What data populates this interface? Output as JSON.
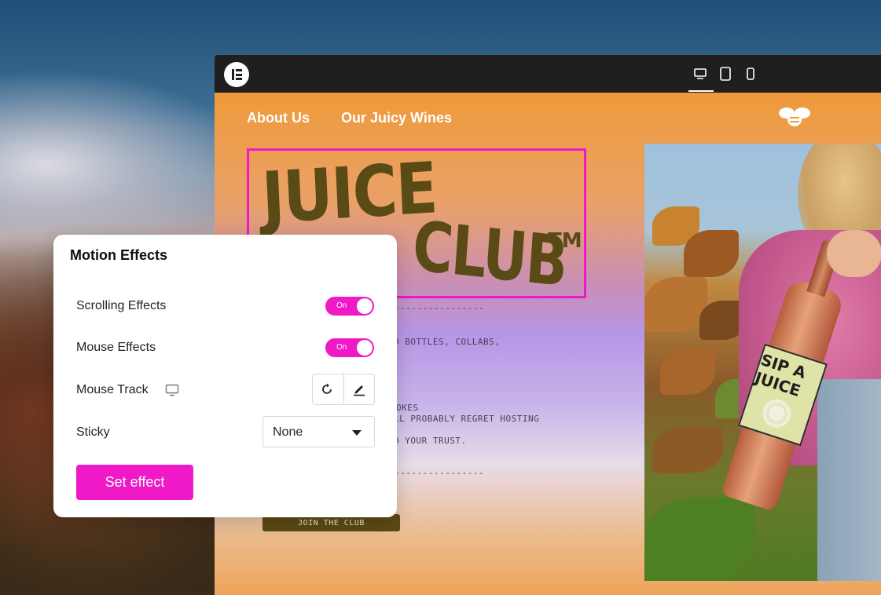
{
  "editor": {
    "logo_icon": "elementor-logo-icon",
    "devices": [
      {
        "name": "desktop",
        "icon": "desktop-icon",
        "active": true
      },
      {
        "name": "tablet",
        "icon": "tablet-icon",
        "active": false
      },
      {
        "name": "mobile",
        "icon": "mobile-icon",
        "active": false
      }
    ]
  },
  "site": {
    "nav": {
      "about": "About Us",
      "wines": "Our Juicy Wines"
    },
    "logo_icon": "bee-logo-icon",
    "hero": {
      "word1": "JUICE",
      "word2": "CLUB",
      "tm": "TM"
    },
    "text_lines": {
      "divider1": "-----------------",
      "line1": "D BOTTLES, COLLABS,",
      "line2": "OKES",
      "line3": "LL PROBABLY REGRET HOSTING",
      "line4": "D YOUR TRUST.",
      "divider2": "-----------------"
    },
    "join_button": "JOIN THE CLUB",
    "bottle_label": {
      "brand": "SIP A JUICE"
    },
    "accent_color": "#f019c8"
  },
  "panel": {
    "title": "Motion Effects",
    "scrolling": {
      "label": "Scrolling Effects",
      "state": "On"
    },
    "mouse": {
      "label": "Mouse Effects",
      "state": "On"
    },
    "mouse_track": {
      "label": "Mouse Track",
      "icon": "desktop-icon",
      "actions": [
        "reset-icon",
        "edit-icon"
      ]
    },
    "sticky": {
      "label": "Sticky",
      "value": "None"
    },
    "set_button": "Set effect"
  }
}
